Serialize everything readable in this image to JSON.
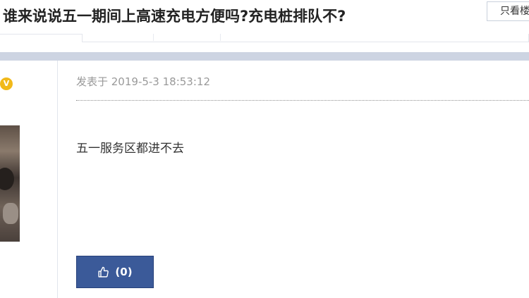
{
  "header": {
    "thread_title": "谁来说说五一期间上高速充电方便吗?充电桩排队不?",
    "only_author_label": "只看楼"
  },
  "author": {
    "vip_badge": "V"
  },
  "post": {
    "time": "发表于 2019-5-3 18:53:12",
    "body": "五一服务区都进不去",
    "like_count": "(0)"
  },
  "icons": [
    "vip-badge-icon",
    "thumbs-up-icon"
  ],
  "colors": {
    "like_button": "#3b5a99",
    "separator": "#cdd4e2",
    "vip": "#f1b91a"
  }
}
